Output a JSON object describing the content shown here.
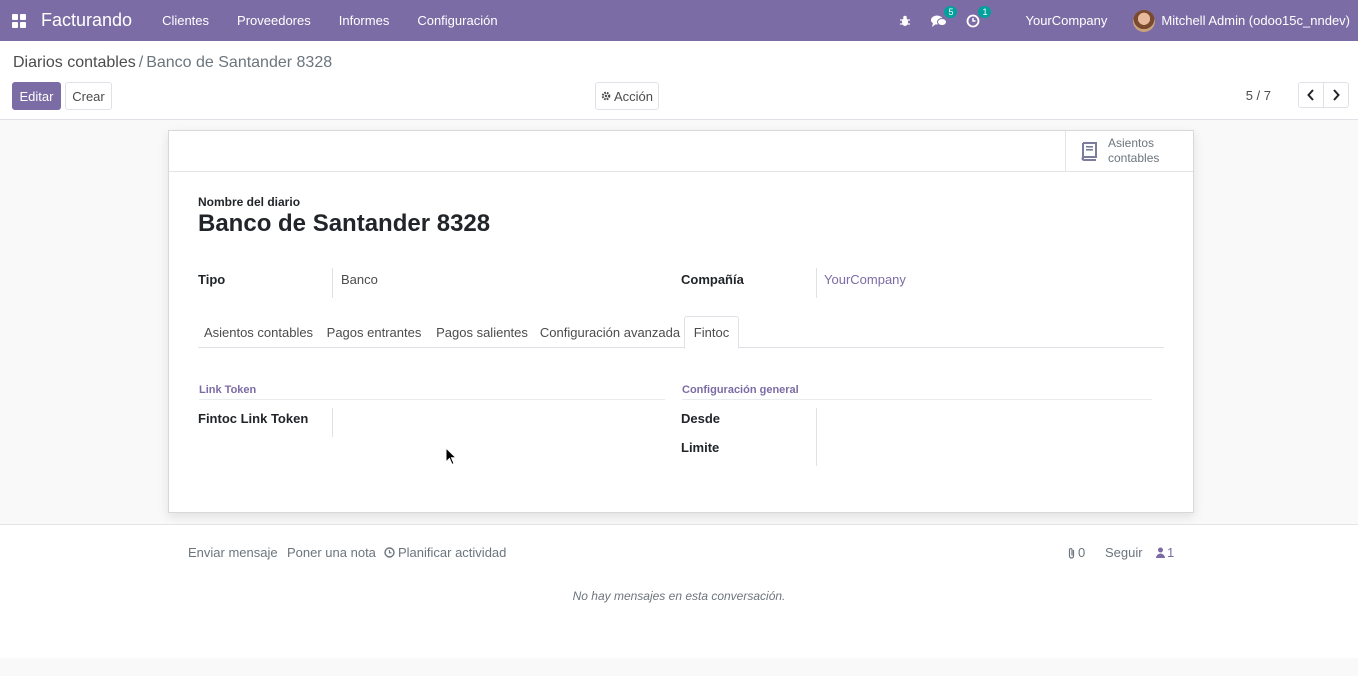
{
  "navbar": {
    "app_name": "Facturando",
    "menu": [
      "Clientes",
      "Proveedores",
      "Informes",
      "Configuración"
    ],
    "messages_badge": "5",
    "activities_badge": "1",
    "company": "YourCompany",
    "user": "Mitchell Admin (odoo15c_nndev)",
    "bg_color": "#7c6ca5"
  },
  "breadcrumb": {
    "parent": "Diarios contables",
    "separator": "/",
    "current": "Banco de Santander 8328"
  },
  "toolbar": {
    "edit_label": "Editar",
    "create_label": "Crear",
    "action_label": "Acción",
    "pager": "5 / 7"
  },
  "smart_button": {
    "label_line1": "Asientos",
    "label_line2": "contables"
  },
  "form": {
    "name_label": "Nombre del diario",
    "name_value": "Banco de Santander 8328",
    "type_label": "Tipo",
    "type_value": "Banco",
    "company_label": "Compañía",
    "company_value": "YourCompany"
  },
  "tabs": [
    {
      "label": "Asientos contables"
    },
    {
      "label": "Pagos entrantes"
    },
    {
      "label": "Pagos salientes"
    },
    {
      "label": "Configuración avanzada"
    },
    {
      "label": "Fintoc",
      "active": true
    }
  ],
  "fintoc_tab": {
    "link_group_title": "Link Token",
    "link_token_label": "Fintoc Link Token",
    "link_token_value": "",
    "config_group_title": "Configuración general",
    "from_label": "Desde",
    "from_value": "",
    "limit_label": "Limite",
    "limit_value": ""
  },
  "chatter": {
    "send_message": "Enviar mensaje",
    "log_note": "Poner una nota",
    "schedule_activity": "Planificar actividad",
    "attachments_count": "0",
    "follow_label": "Seguir",
    "followers_count": "1",
    "empty_text": "No hay mensajes en esta conversación."
  }
}
